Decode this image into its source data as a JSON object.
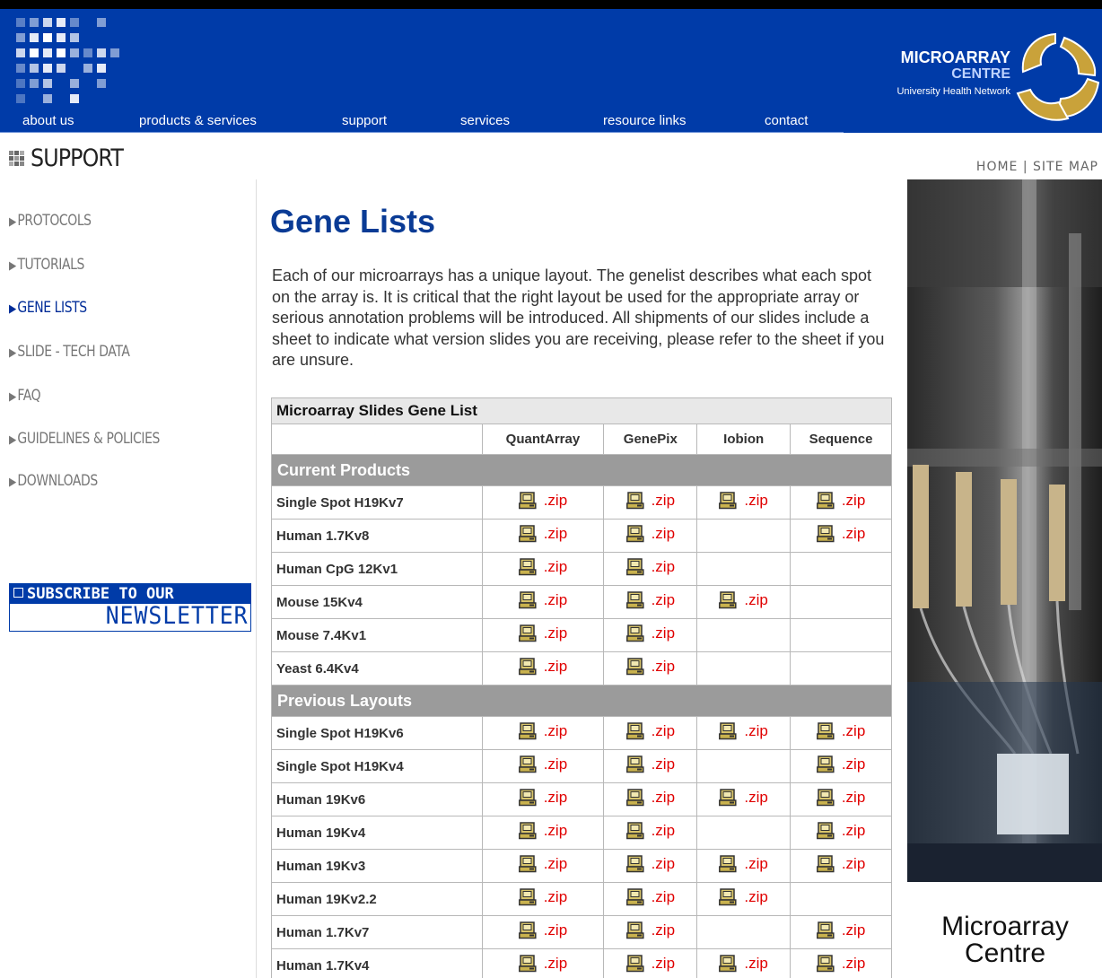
{
  "colors": {
    "header_blue": "#003ba8",
    "title_blue": "#0a3b95",
    "group_gray": "#9b9b9b",
    "link_red": "#e00000"
  },
  "brand": {
    "line1": "MICROARRAY",
    "line2": "CENTRE",
    "line3": "University Health Network"
  },
  "nav": {
    "items": [
      "about us",
      "products & services",
      "support",
      "services",
      "resource links",
      "contact"
    ]
  },
  "section": {
    "title": "SUPPORT",
    "icon": "grid-squares-icon"
  },
  "util": {
    "home": "HOME",
    "separator": " | ",
    "sitemap": "SITE MAP"
  },
  "sidebar": {
    "items": [
      {
        "label": "PROTOCOLS"
      },
      {
        "label": "TUTORIALS"
      },
      {
        "label": "GENE LISTS",
        "active": true
      },
      {
        "label": "SLIDE - TECH DATA"
      },
      {
        "label": "FAQ"
      },
      {
        "label": "GUIDELINES & POLICIES"
      },
      {
        "label": "DOWNLOADS"
      }
    ],
    "newsletter": {
      "line1": "SUBSCRIBE TO OUR",
      "line2": "NEWSLETTER"
    }
  },
  "main": {
    "title": "Gene Lists",
    "intro": "Each of our microarrays has a unique layout. The genelist describes what each spot on the array is. It is critical that the right layout be used for the appropriate array or serious annotation problems will be introduced. All shipments of our slides include a sheet to indicate what version slides you are receiving, please refer to the sheet if you are unsure.",
    "table": {
      "caption": "Microarray Slides Gene List",
      "columns": [
        "QuantArray",
        "GenePix",
        "Iobion",
        "Sequence"
      ],
      "link_text": ".zip",
      "groups": [
        {
          "name": "Current Products",
          "rows": [
            {
              "name": "Single Spot H19Kv7",
              "files": [
                true,
                true,
                true,
                true
              ]
            },
            {
              "name": "Human 1.7Kv8",
              "files": [
                true,
                true,
                false,
                true
              ]
            },
            {
              "name": "Human CpG 12Kv1",
              "files": [
                true,
                true,
                false,
                false
              ]
            },
            {
              "name": "Mouse 15Kv4",
              "files": [
                true,
                true,
                true,
                false
              ]
            },
            {
              "name": "Mouse 7.4Kv1",
              "files": [
                true,
                true,
                false,
                false
              ]
            },
            {
              "name": "Yeast 6.4Kv4",
              "files": [
                true,
                true,
                false,
                false
              ]
            }
          ]
        },
        {
          "name": "Previous Layouts",
          "rows": [
            {
              "name": "Single Spot H19Kv6",
              "files": [
                true,
                true,
                true,
                true
              ]
            },
            {
              "name": "Single Spot H19Kv4",
              "files": [
                true,
                true,
                false,
                true
              ]
            },
            {
              "name": "Human 19Kv6",
              "files": [
                true,
                true,
                true,
                true
              ]
            },
            {
              "name": "Human 19Kv4",
              "files": [
                true,
                true,
                false,
                true
              ]
            },
            {
              "name": "Human 19Kv3",
              "files": [
                true,
                true,
                true,
                true
              ]
            },
            {
              "name": "Human 19Kv2.2",
              "files": [
                true,
                true,
                true,
                false
              ]
            },
            {
              "name": "Human 1.7Kv7",
              "files": [
                true,
                true,
                false,
                true
              ]
            },
            {
              "name": "Human 1.7Kv4",
              "files": [
                true,
                true,
                true,
                true
              ]
            }
          ]
        }
      ]
    }
  },
  "photo": {
    "caption": "Microarray Centre"
  }
}
